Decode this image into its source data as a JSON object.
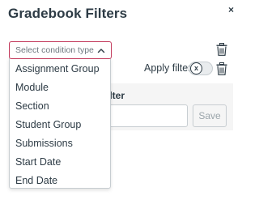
{
  "dialog": {
    "title": "Gradebook Filters",
    "close_glyph": "×"
  },
  "condition_select": {
    "placeholder": "Select condition type",
    "border_color": "#c13558",
    "options": [
      "Assignment Group",
      "Module",
      "Section",
      "Student Group",
      "Submissions",
      "Start Date",
      "End Date"
    ]
  },
  "filter_row": {
    "apply_label": "Apply filter",
    "toggle_glyph": "x"
  },
  "save_panel": {
    "label": "filter",
    "save_label": "Save"
  },
  "icons": [
    "close-icon",
    "trash-icon",
    "chevron-up-icon",
    "x-icon"
  ]
}
